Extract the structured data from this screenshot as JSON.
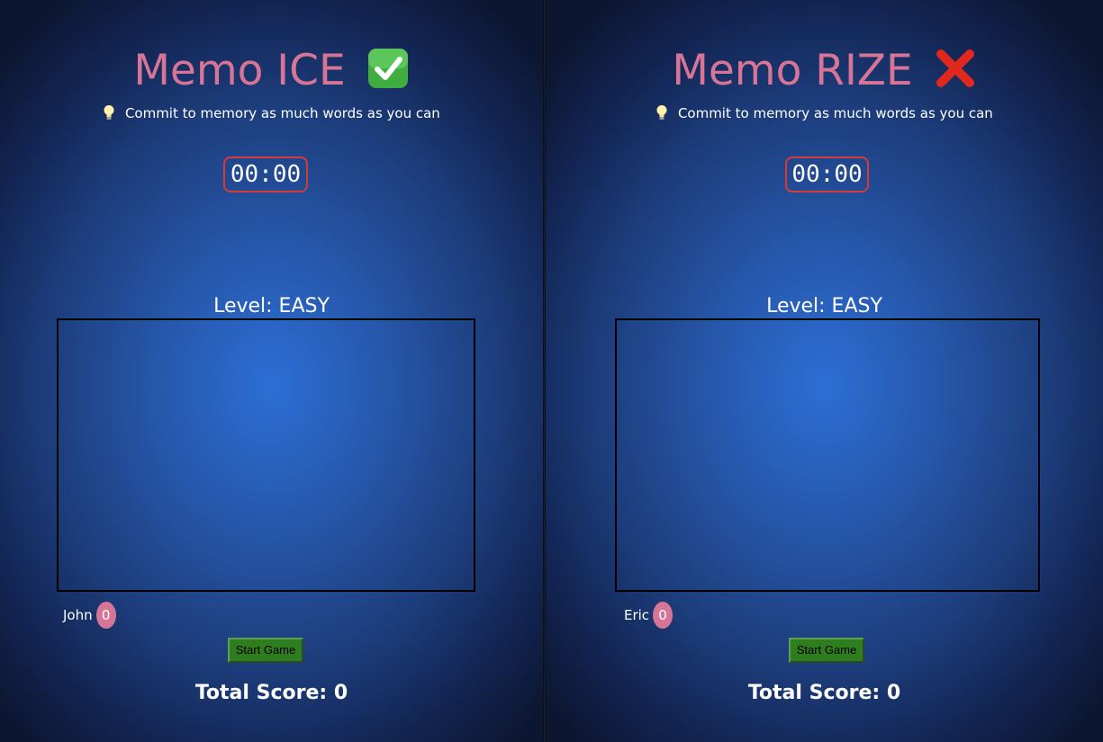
{
  "left_panel": {
    "title": "Memo ICE",
    "status_icon": "check-mark-icon",
    "hint": "Commit to memory as much words as you can",
    "hint_icon": "light-bulb-icon",
    "timer": "00:00",
    "level": "Level: EASY",
    "player_name": "John",
    "player_score": "0",
    "start_button": "Start Game",
    "total_score": "Total Score: 0"
  },
  "right_panel": {
    "title": "Memo RIZE",
    "status_icon": "cross-mark-icon",
    "hint": "Commit to memory as much words as you can",
    "hint_icon": "light-bulb-icon",
    "timer": "00:00",
    "level": "Level: EASY",
    "player_name": "Eric",
    "player_score": "0",
    "start_button": "Start Game",
    "total_score": "Total Score: 0"
  },
  "colors": {
    "title": "#d77596",
    "timer_border": "#d83a3a",
    "score_badge": "#d77596",
    "start_button": "#2e7d1e",
    "check_mark": "#3fae3f",
    "cross_mark": "#e0281e"
  }
}
